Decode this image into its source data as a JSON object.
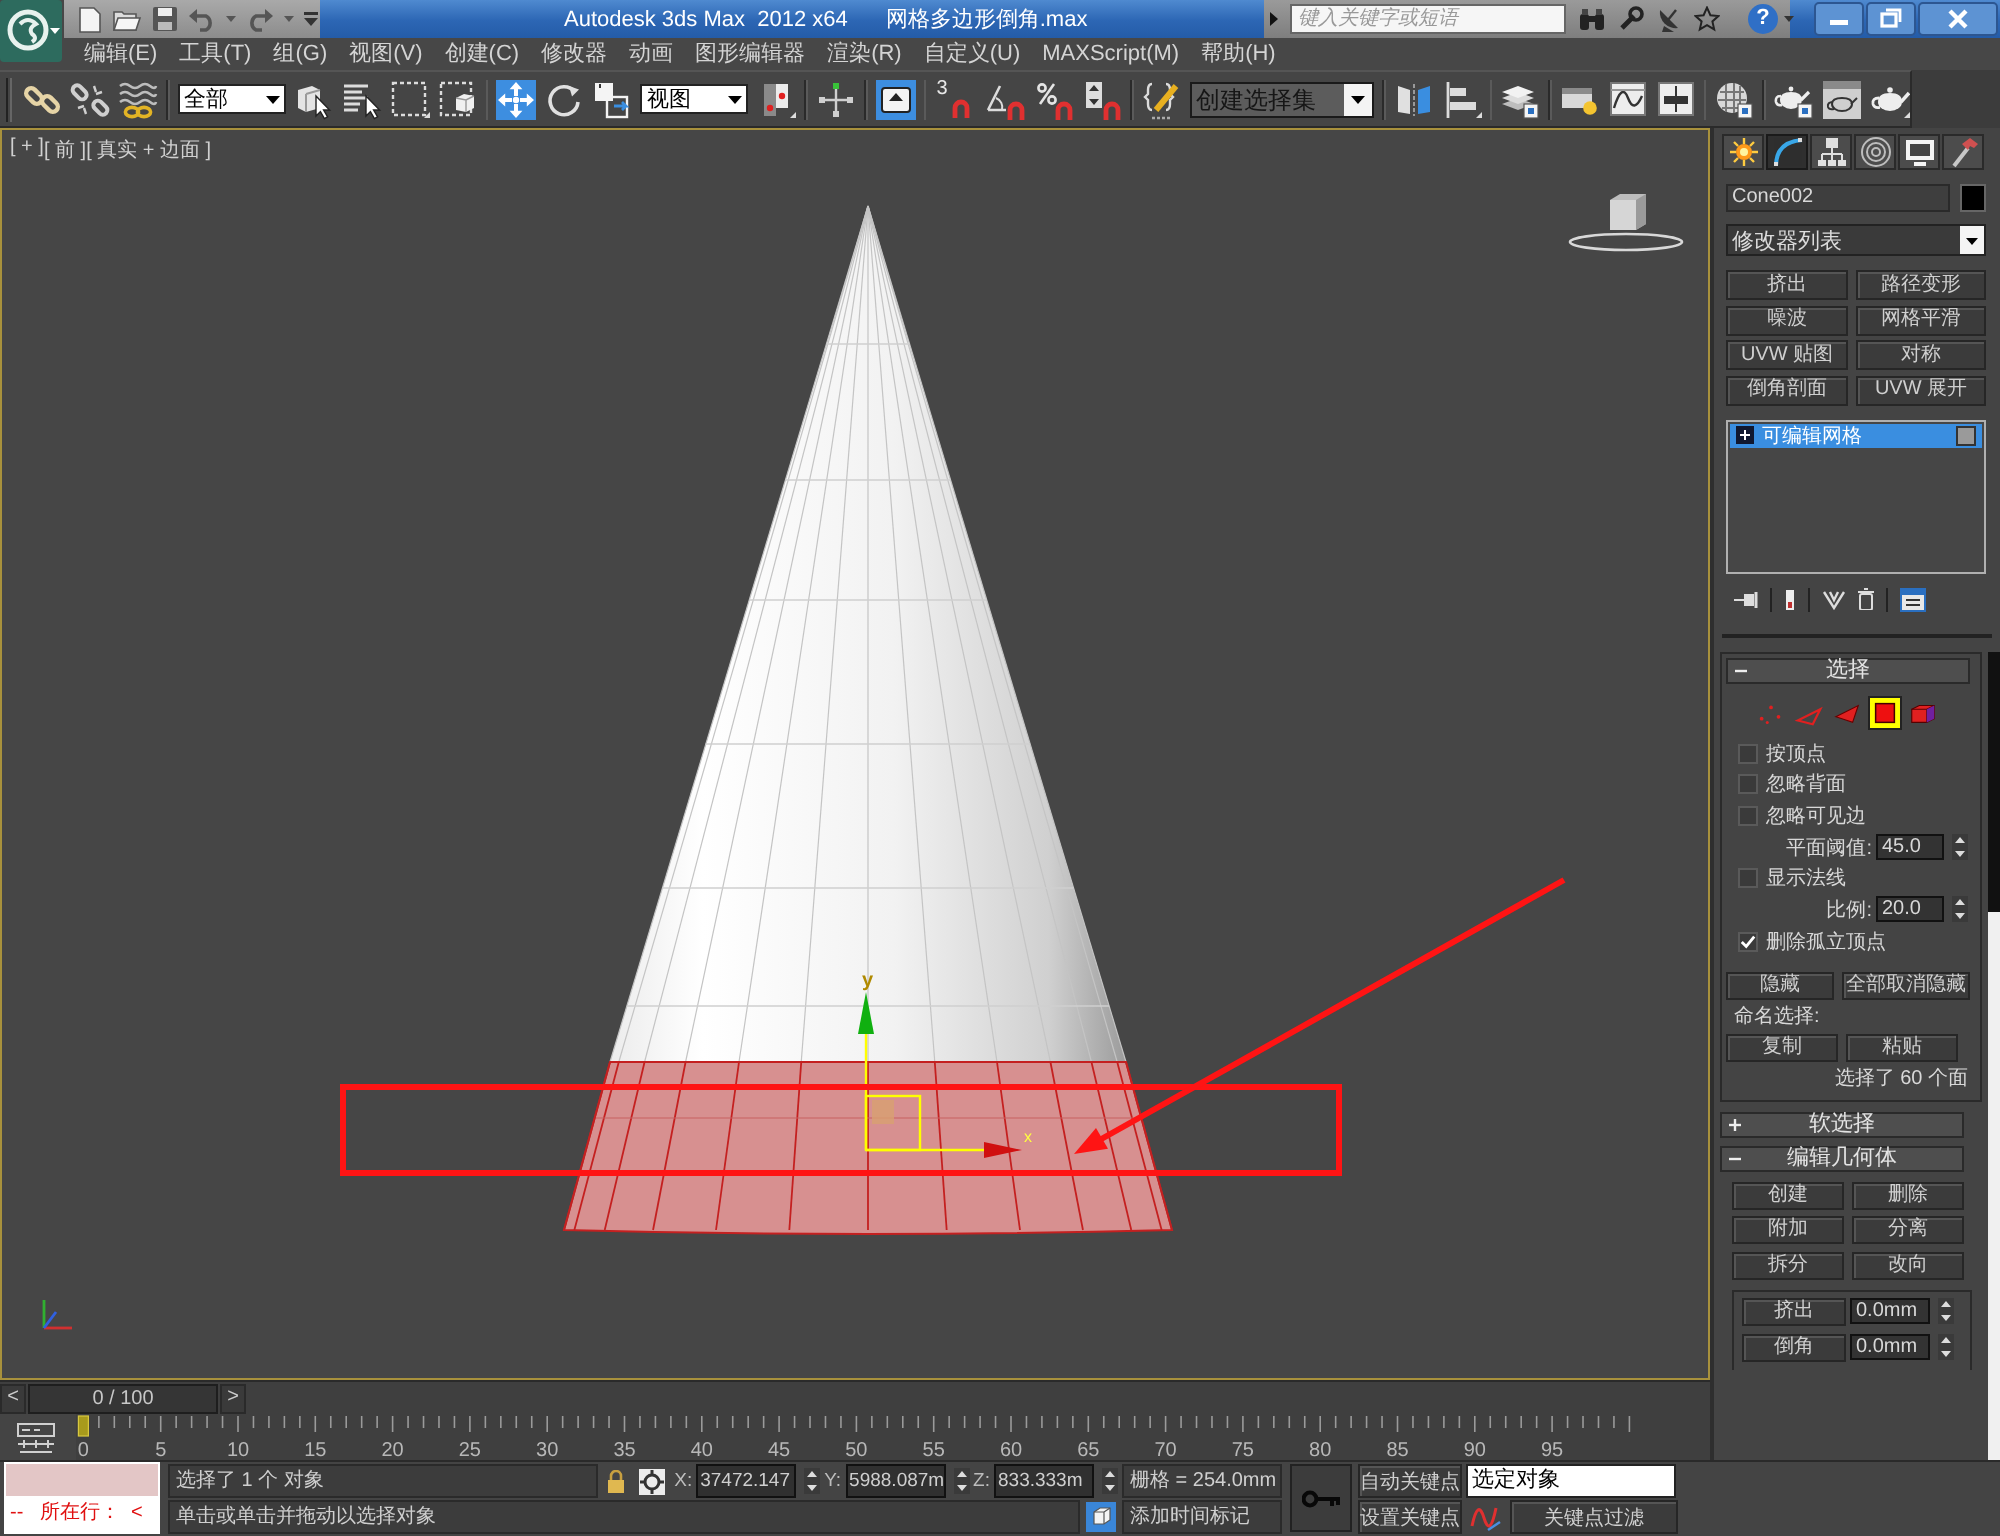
{
  "title_bar": {
    "app_title": "Autodesk 3ds Max  2012 x64",
    "file_name": "网格多边形倒角.max",
    "search": {
      "placeholder": "键入关键字或短语"
    },
    "help": "?"
  },
  "menu": [
    "编辑(E)",
    "工具(T)",
    "组(G)",
    "视图(V)",
    "创建(C)",
    "修改器",
    "动画",
    "图形编辑器",
    "渲染(R)",
    "自定义(U)",
    "MAXScript(M)",
    "帮助(H)"
  ],
  "toolbar": [
    {
      "kind": "link"
    },
    {
      "kind": "unlink"
    },
    {
      "kind": "bind"
    },
    {
      "kind": "separator"
    },
    {
      "kind": "dropdown",
      "value": "全部"
    },
    {
      "kind": "select"
    },
    {
      "kind": "select-by-name"
    },
    {
      "kind": "region"
    },
    {
      "kind": "crossing"
    },
    {
      "kind": "separator"
    },
    {
      "kind": "move",
      "selected": true
    },
    {
      "kind": "rotate",
      "selected": false
    },
    {
      "kind": "scale",
      "selected": false
    },
    {
      "kind": "dropdown",
      "value": "视图"
    },
    {
      "kind": "pivot"
    },
    {
      "kind": "separator"
    },
    {
      "kind": "manipulate"
    },
    {
      "kind": "separator"
    },
    {
      "kind": "keyboard",
      "on": true
    },
    {
      "kind": "separator"
    },
    {
      "kind": "snap",
      "label": "3",
      "on": false
    },
    {
      "kind": "angle-snap",
      "on": false
    },
    {
      "kind": "percent-snap",
      "on": false
    },
    {
      "kind": "spinner-snap",
      "on": false
    },
    {
      "kind": "separator"
    },
    {
      "kind": "named-selection"
    },
    {
      "kind": "combo",
      "placeholder": "创建选择集"
    },
    {
      "kind": "separator"
    },
    {
      "kind": "mirror"
    },
    {
      "kind": "align"
    },
    {
      "kind": "separator"
    },
    {
      "kind": "layers"
    },
    {
      "kind": "separator"
    },
    {
      "kind": "ribbon"
    },
    {
      "kind": "curve-editor"
    },
    {
      "kind": "schematic"
    },
    {
      "kind": "separator"
    },
    {
      "kind": "material"
    },
    {
      "kind": "separator"
    },
    {
      "kind": "render-setup"
    },
    {
      "kind": "rendered-frame"
    },
    {
      "kind": "render"
    }
  ],
  "viewport": {
    "label_menus": [
      "[ + ]",
      "[ 前 ]",
      "[ 真实 + 边面 ]"
    ],
    "gizmo": {
      "x_label": "x",
      "y_label": "y"
    }
  },
  "command_panel": {
    "tabs": [
      {
        "kind": "create",
        "selected": false
      },
      {
        "kind": "modify",
        "selected": true
      },
      {
        "kind": "hierarchy",
        "selected": false
      },
      {
        "kind": "motion",
        "selected": false
      },
      {
        "kind": "display",
        "selected": false
      },
      {
        "kind": "utilities",
        "selected": false
      }
    ],
    "object_name": "Cone002",
    "modifier_list": "修改器列表",
    "modifier_buttons": [
      "挤出",
      "路径变形",
      "噪波",
      "网格平滑",
      "UVW 贴图",
      "对称",
      "倒角剖面",
      "UVW 展开"
    ],
    "stack": [
      {
        "label": "可编辑网格",
        "selected": true,
        "expanded": false
      }
    ],
    "selection": {
      "title": "选择",
      "expanded": true,
      "levels": [
        {
          "kind": "vertex",
          "selected": false
        },
        {
          "kind": "edge",
          "selected": false
        },
        {
          "kind": "face",
          "selected": false
        },
        {
          "kind": "polygon",
          "selected": true
        },
        {
          "kind": "element",
          "selected": false
        }
      ],
      "options": [
        {
          "kind": "checkbox",
          "label": "按顶点",
          "checked": false
        },
        {
          "kind": "checkbox",
          "label": "忽略背面",
          "checked": false
        },
        {
          "kind": "checkbox",
          "label": "忽略可见边",
          "checked": false
        },
        {
          "kind": "spinner",
          "label": "平面阈值:",
          "value": "45.0"
        },
        {
          "kind": "checkbox",
          "label": "显示法线",
          "checked": false
        },
        {
          "kind": "spinner",
          "label": "比例:",
          "value": "20.0"
        },
        {
          "kind": "checkbox",
          "label": "删除孤立顶点",
          "checked": true
        }
      ],
      "hide_buttons": [
        "隐藏",
        "全部取消隐藏"
      ],
      "named_label": "命名选择:",
      "named_buttons": [
        "复制",
        "粘贴"
      ],
      "summary": "选择了 60 个面"
    },
    "soft_selection": {
      "title": "软选择",
      "expanded": false
    },
    "edit_geometry": {
      "title": "编辑几何体",
      "expanded": true,
      "buttons": [
        "创建",
        "删除",
        "附加",
        "分离",
        "拆分",
        "改向"
      ],
      "spinners": [
        {
          "label": "挤出",
          "value": "0.0mm"
        },
        {
          "label": "倒角",
          "value": "0.0mm"
        }
      ]
    }
  },
  "time_slider": {
    "prev": "<",
    "label": "0 / 100",
    "next": ">",
    "level": 0
  },
  "timeline": {
    "ticks": [
      "0",
      "5",
      "10",
      "15",
      "20",
      "25",
      "30",
      "35",
      "40",
      "45",
      "50",
      "55",
      "60",
      "65",
      "70",
      "75",
      "80",
      "85",
      "90",
      "95"
    ]
  },
  "status_bar": {
    "listener_output": "--   所在行：  <",
    "selection_info": "选择了 1 个 对象",
    "coordinates": [
      {
        "axis": "X:",
        "value": "37472.147"
      },
      {
        "axis": "Y:",
        "value": "5988.087m"
      },
      {
        "axis": "Z:",
        "value": "833.333m"
      }
    ],
    "grid": "栅格 = 254.0mm",
    "prompt": "单击或单击并拖动以选择对象",
    "time_tag": "添加时间标记",
    "auto_key": "自动关键点",
    "key_mode": "选定对象",
    "set_key": "设置关键点",
    "key_filters": "关键点过滤"
  }
}
